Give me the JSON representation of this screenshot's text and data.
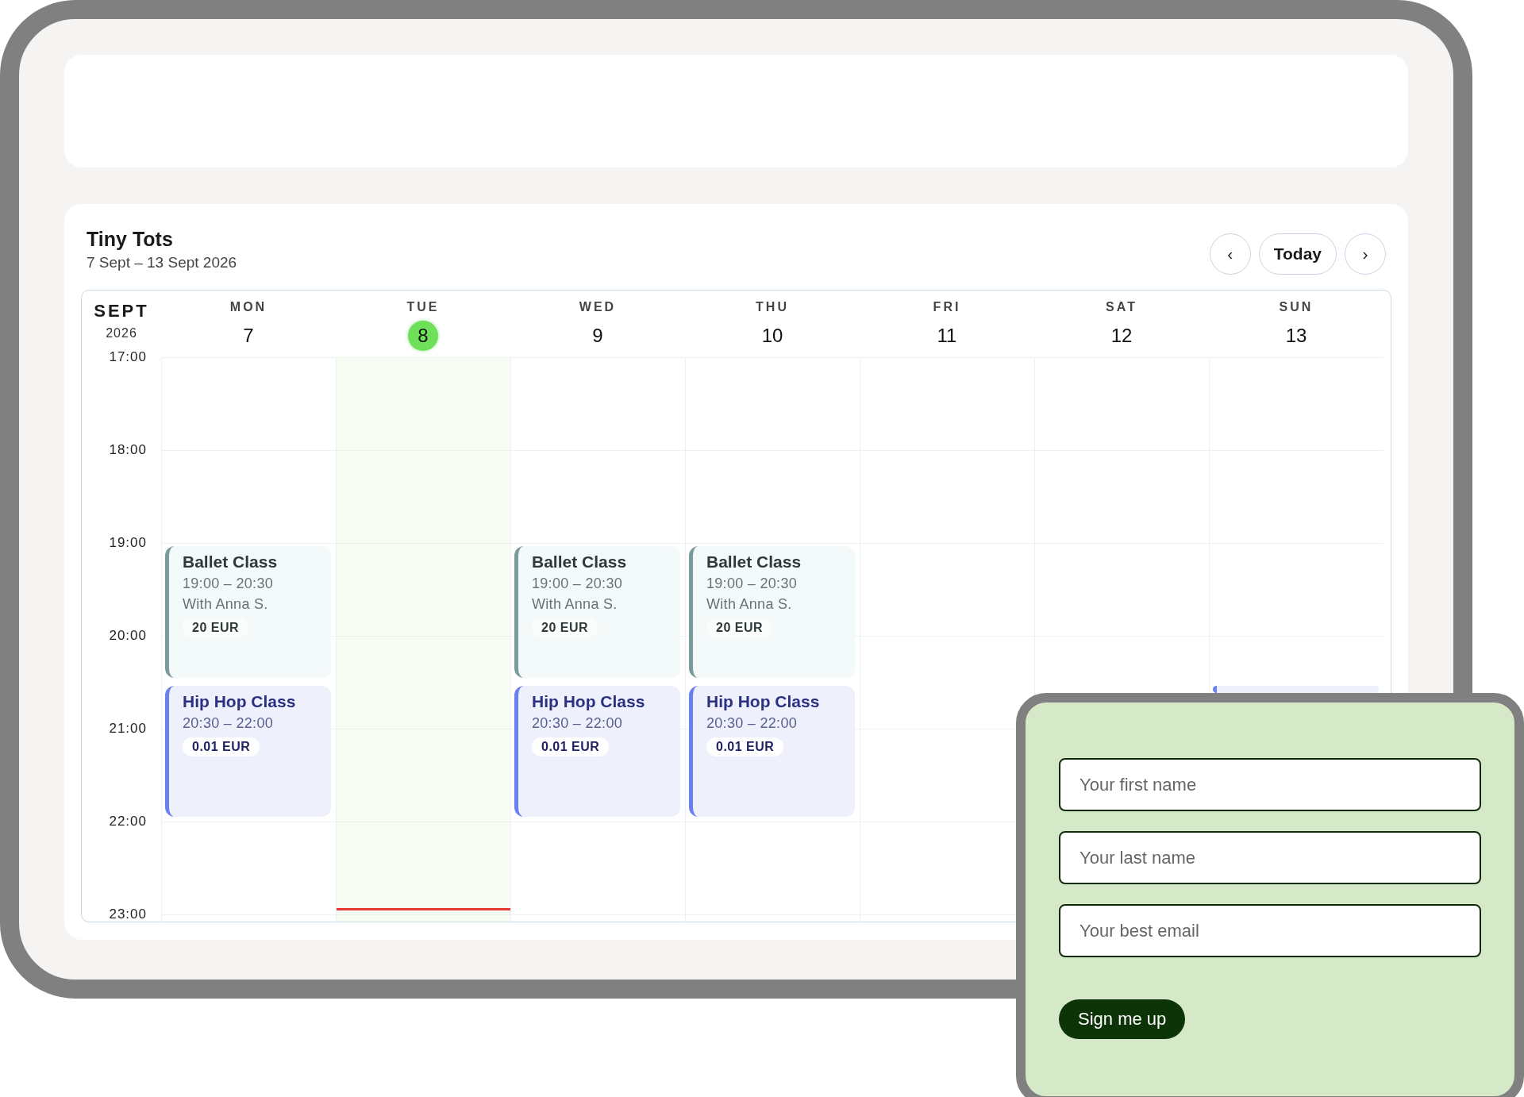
{
  "calendar": {
    "title": "Tiny Tots",
    "range": "7 Sept – 13 Sept 2026",
    "nav": [
      {
        "kind": "prev",
        "label": "‹"
      },
      {
        "kind": "today",
        "label": "Today"
      },
      {
        "kind": "next",
        "label": "›"
      }
    ],
    "month": "SEPT",
    "year": "2026",
    "days": [
      {
        "name": "MON",
        "number": "7",
        "selected": false,
        "events": [
          {
            "kind": "ballet",
            "title": "Ballet Class",
            "time": "19:00 – 20:30",
            "teacher": "With Anna S.",
            "price": "20 EUR"
          },
          {
            "kind": "hiphop",
            "title": "Hip Hop Class",
            "time": "20:30 – 22:00",
            "price": "0.01 EUR"
          }
        ]
      },
      {
        "name": "TUE",
        "number": "8",
        "selected": true
      },
      {
        "name": "WED",
        "number": "9",
        "selected": false,
        "events": [
          {
            "kind": "ballet",
            "title": "Ballet Class",
            "time": "19:00 – 20:30",
            "teacher": "With Anna S.",
            "price": "20 EUR"
          },
          {
            "kind": "hiphop",
            "title": "Hip Hop Class",
            "time": "20:30 – 22:00",
            "price": "0.01 EUR"
          }
        ]
      },
      {
        "name": "THU",
        "number": "10",
        "selected": false,
        "events": [
          {
            "kind": "ballet",
            "title": "Ballet Class",
            "time": "19:00 – 20:30",
            "teacher": "With Anna S.",
            "price": "20 EUR"
          },
          {
            "kind": "hiphop",
            "title": "Hip Hop Class",
            "time": "20:30 – 22:00",
            "price": "0.01 EUR"
          }
        ]
      },
      {
        "name": "FRI",
        "number": "11",
        "selected": false
      },
      {
        "name": "SAT",
        "number": "12",
        "selected": false
      },
      {
        "name": "SUN",
        "number": "13",
        "selected": false,
        "events": [
          {
            "kind": "hiphop"
          }
        ]
      }
    ],
    "hours": [
      "17:00",
      "18:00",
      "19:00",
      "20:00",
      "21:00",
      "22:00",
      "23:00"
    ]
  },
  "signup": {
    "fields": [
      {
        "placeholder": "Your first name"
      },
      {
        "placeholder": "Your last name"
      },
      {
        "placeholder": "Your best email"
      }
    ],
    "button": "Sign me up"
  }
}
